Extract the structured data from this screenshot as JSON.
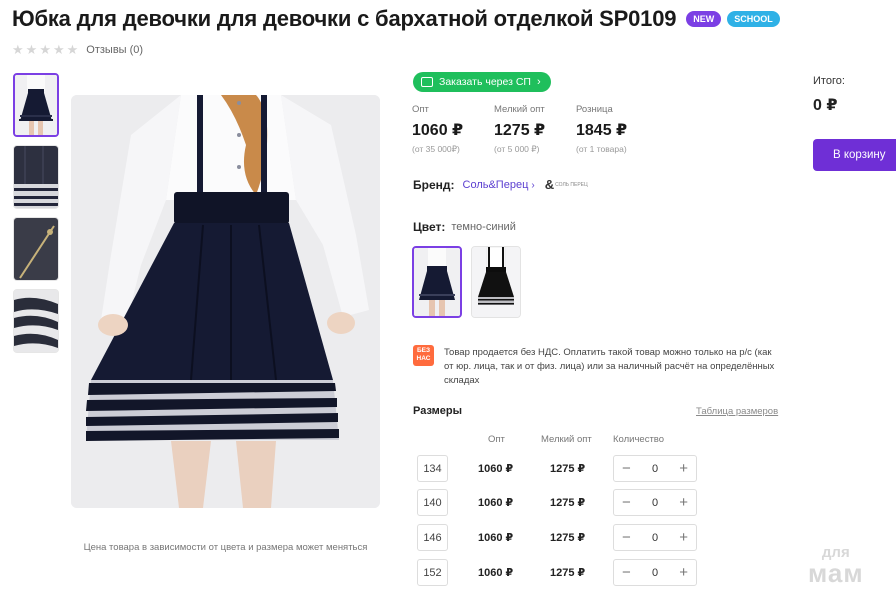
{
  "product": {
    "title": "Юбка для девочки для девочки с бархатной отделкой SP0109",
    "badges": [
      "NEW",
      "SCHOOL"
    ],
    "rating_stars": 0,
    "reviews_label": "Отзывы (0)"
  },
  "gallery": {
    "thumbnail_count": 4,
    "active_index": 0,
    "note": "Цена товара в зависимости от цвета и размера может меняться"
  },
  "order_button": {
    "label": "Заказать через СП"
  },
  "prices": [
    {
      "label": "Опт",
      "value": "1060 ₽",
      "note": "(от 35 000₽)"
    },
    {
      "label": "Мелкий опт",
      "value": "1275 ₽",
      "note": "(от 5 000 ₽)"
    },
    {
      "label": "Розница",
      "value": "1845 ₽",
      "note": "(от 1 товара)"
    }
  ],
  "total": {
    "label": "Итого:",
    "value": "0 ₽"
  },
  "cart_button": {
    "label": "В корзину"
  },
  "brand": {
    "label": "Бренд:",
    "name": "Соль&Перец",
    "logo_text": "СОЛЬ ПЕРЕЦ"
  },
  "color": {
    "label": "Цвет:",
    "value": "темно-синий",
    "swatch_count": 2,
    "active_index": 0
  },
  "vat": {
    "icon_text_1": "БЕЗ",
    "icon_text_2": "НАС",
    "text": "Товар продается без НДС. Оплатить такой товар можно только на р/с (как от юр. лица, так и от физ. лица) или за наличный расчёт на определённых складах"
  },
  "sizes": {
    "title": "Размеры",
    "table_link": "Таблица размеров",
    "headers": [
      "Опт",
      "Мелкий опт",
      "Количество"
    ],
    "rows": [
      {
        "size": "134",
        "opt": "1060 ₽",
        "small_opt": "1275 ₽",
        "qty": "0"
      },
      {
        "size": "140",
        "opt": "1060 ₽",
        "small_opt": "1275 ₽",
        "qty": "0"
      },
      {
        "size": "146",
        "opt": "1060 ₽",
        "small_opt": "1275 ₽",
        "qty": "0"
      },
      {
        "size": "152",
        "opt": "1060 ₽",
        "small_opt": "1275 ₽",
        "qty": "0"
      }
    ],
    "qty_minus": "−",
    "qty_plus": "+"
  },
  "watermark": {
    "line1": "для",
    "line2": "мам"
  },
  "colors": {
    "accent": "#7b3fe4",
    "cart": "#6f2fd6",
    "order": "#1fbf5c",
    "school_badge": "#2fb1e6",
    "vat_icon": "#ff6b3d",
    "skirt": "#151a33"
  }
}
